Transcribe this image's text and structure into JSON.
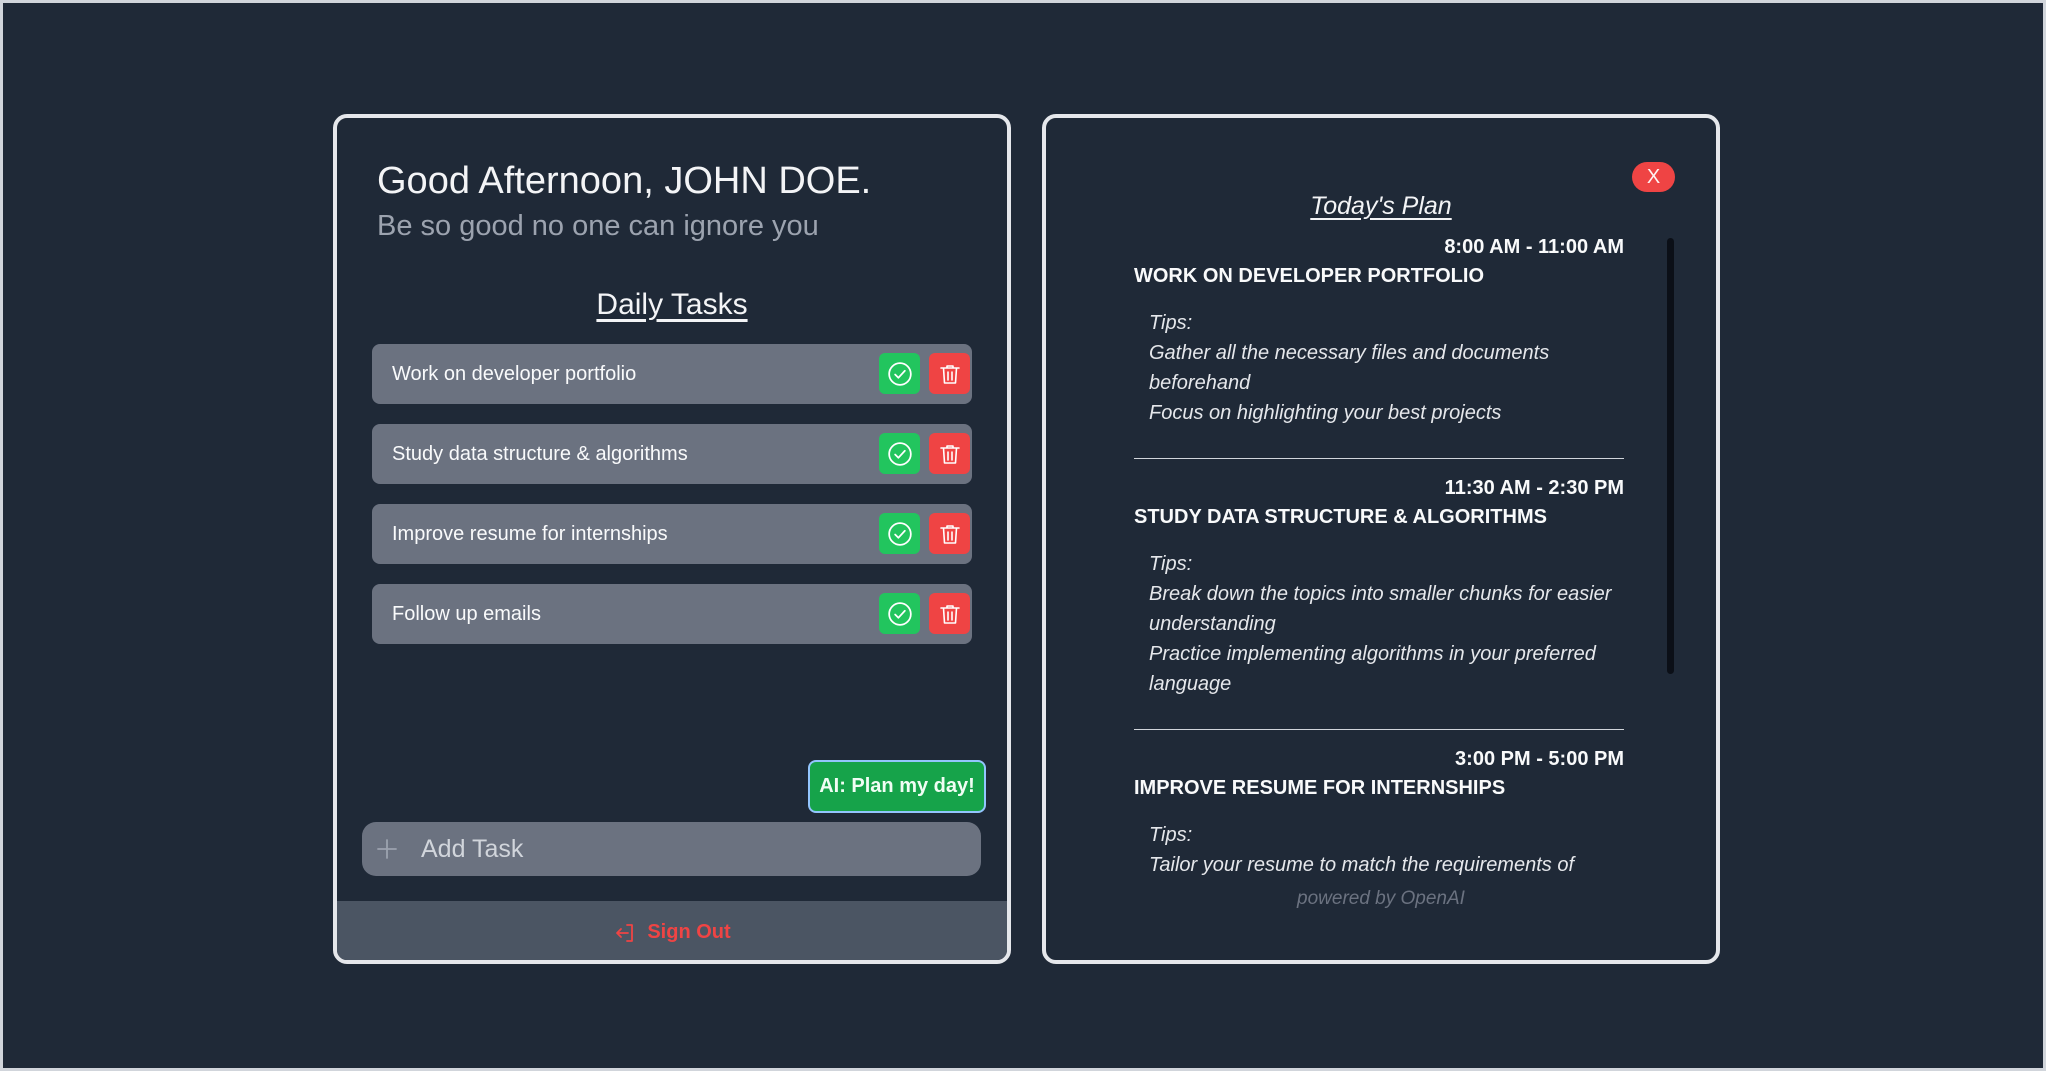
{
  "header": {
    "greeting": "Good Afternoon, JOHN DOE.",
    "subtitle": "Be so good no one can ignore you"
  },
  "tasks": {
    "heading": "Daily Tasks",
    "items": [
      {
        "label": "Work on developer portfolio"
      },
      {
        "label": "Study data structure & algorithms"
      },
      {
        "label": "Improve resume for internships"
      },
      {
        "label": "Follow up emails"
      }
    ]
  },
  "ai_button": {
    "label": "AI: Plan my day!"
  },
  "add_task": {
    "placeholder": "Add Task",
    "value": ""
  },
  "sign_out": {
    "label": "Sign Out"
  },
  "plan": {
    "close_label": "X",
    "title": "Today's Plan",
    "items": [
      {
        "time": "8:00 AM - 11:00 AM",
        "name": "WORK ON DEVELOPER PORTFOLIO",
        "tips_label": "Tips:",
        "tips": [
          "Gather all the necessary files and documents beforehand",
          "Focus on highlighting your best projects"
        ]
      },
      {
        "time": "11:30 AM - 2:30 PM",
        "name": "STUDY DATA STRUCTURE & ALGORITHMS",
        "tips_label": "Tips:",
        "tips": [
          "Break down the topics into smaller chunks for easier understanding",
          "Practice implementing algorithms in your preferred language"
        ]
      },
      {
        "time": "3:00 PM - 5:00 PM",
        "name": "IMPROVE RESUME FOR INTERNSHIPS",
        "tips_label": "Tips:",
        "tips": [
          "Tailor your resume to match the requirements of"
        ]
      }
    ],
    "powered_by": "powered by OpenAI"
  },
  "colors": {
    "background": "#1f2937",
    "task_row": "#6b7280",
    "done": "#22c55e",
    "delete": "#ef4444",
    "ai_button": "#16a34a",
    "sign_out_text": "#ef4444"
  }
}
